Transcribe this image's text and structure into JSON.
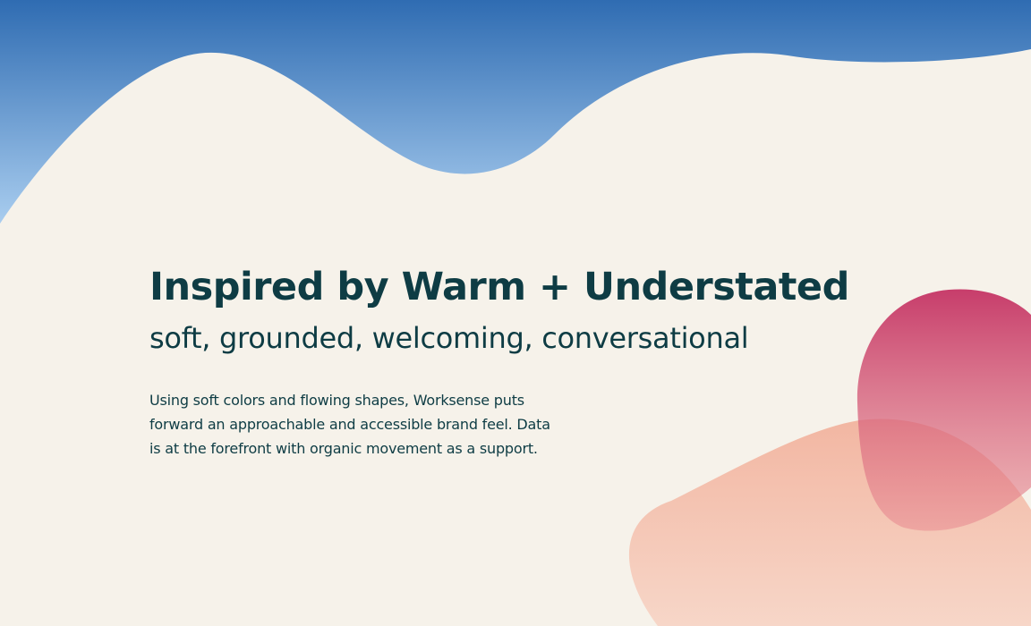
{
  "colors": {
    "background": "#f6f2ea",
    "sky_top": "#2f6cb2",
    "sky_bottom": "#a9cdef",
    "text": "#0e3c44",
    "magenta_blob": "#c73d6b",
    "peach_blob": "#f2b9a6"
  },
  "slide": {
    "headline": "Inspired by Warm + Understated",
    "subhead": "soft, grounded, welcoming, conversational",
    "body_lines": [
      "Using soft colors and flowing shapes, Worksense puts",
      "forward an approachable and accessible brand feel. Data",
      "is at the forefront with organic movement as a support."
    ]
  }
}
